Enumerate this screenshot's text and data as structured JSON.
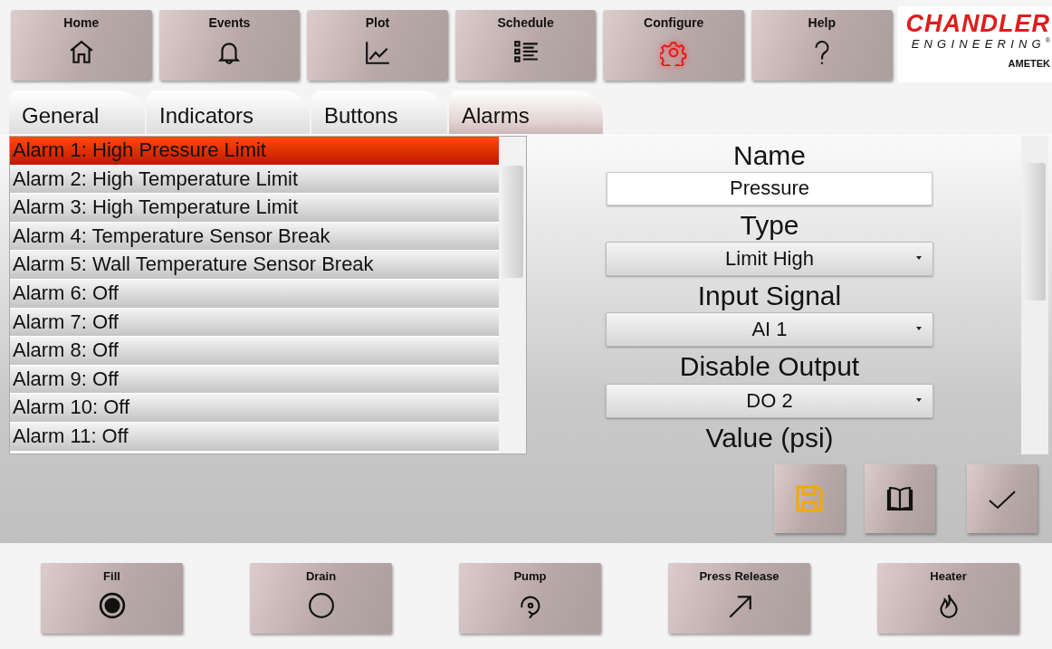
{
  "nav": [
    {
      "label": "Home",
      "selected": false
    },
    {
      "label": "Events",
      "selected": false
    },
    {
      "label": "Plot",
      "selected": false
    },
    {
      "label": "Schedule",
      "selected": false
    },
    {
      "label": "Configure",
      "selected": true
    },
    {
      "label": "Help",
      "selected": false
    }
  ],
  "logo": {
    "name": "CHANDLER",
    "sub": "ENGINEERING",
    "mark": "®",
    "parent": "AMETEK"
  },
  "tabs": [
    {
      "label": "General",
      "selected": false
    },
    {
      "label": "Indicators",
      "selected": false
    },
    {
      "label": "Buttons",
      "selected": false
    },
    {
      "label": "Alarms",
      "selected": true
    }
  ],
  "alarms": [
    {
      "label": "Alarm 1: High Pressure Limit",
      "selected": true
    },
    {
      "label": "Alarm 2: High Temperature Limit",
      "selected": false
    },
    {
      "label": "Alarm 3: High Temperature Limit",
      "selected": false
    },
    {
      "label": "Alarm 4: Temperature Sensor Break",
      "selected": false
    },
    {
      "label": "Alarm 5: Wall Temperature Sensor Break",
      "selected": false
    },
    {
      "label": "Alarm 6: Off",
      "selected": false
    },
    {
      "label": "Alarm 7: Off",
      "selected": false
    },
    {
      "label": "Alarm 8: Off",
      "selected": false
    },
    {
      "label": "Alarm 9: Off",
      "selected": false
    },
    {
      "label": "Alarm 10: Off",
      "selected": false
    },
    {
      "label": "Alarm 11: Off",
      "selected": false
    }
  ],
  "form": [
    {
      "label": "Name",
      "kind": "text",
      "value": "Pressure"
    },
    {
      "label": "Type",
      "kind": "dropdown",
      "value": "Limit High"
    },
    {
      "label": "Input Signal",
      "kind": "dropdown",
      "value": "AI 1"
    },
    {
      "label": "Disable Output",
      "kind": "dropdown",
      "value": "DO 2"
    },
    {
      "label": "Value (psi)",
      "kind": "heading"
    }
  ],
  "controls": [
    {
      "label": "Fill"
    },
    {
      "label": "Drain"
    },
    {
      "label": "Pump"
    },
    {
      "label": "Press Release"
    },
    {
      "label": "Heater"
    }
  ]
}
